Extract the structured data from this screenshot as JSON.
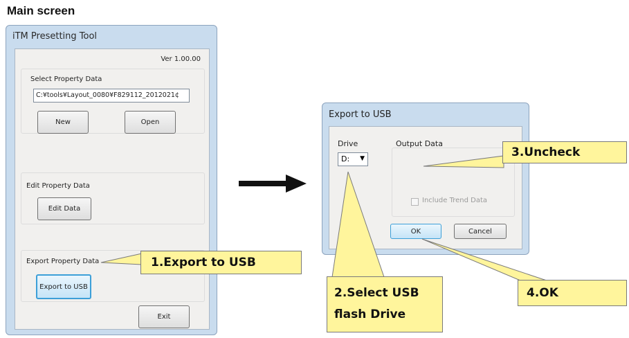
{
  "heading": "Main screen",
  "main_window": {
    "title": "iTM Presetting Tool",
    "version": "Ver 1.00.00",
    "select_group_label": "Select Property Data",
    "path_value": "C:¥tools¥Layout_0080¥F829112_2012021¢",
    "new_label": "New",
    "open_label": "Open",
    "edit_group_label": "Edit Property Data",
    "edit_label": "Edit Data",
    "export_group_label": "Export Property Data",
    "export_label": "Export to USB",
    "exit_label": "Exit"
  },
  "dialog": {
    "title": "Export to USB",
    "drive_label": "Drive",
    "drive_value": "D:",
    "output_label": "Output Data",
    "include_trend_label": "Include Trend Data",
    "include_trend_checked": false,
    "ok_label": "OK",
    "cancel_label": "Cancel"
  },
  "callouts": {
    "step1": "1.Export to USB",
    "step2_line1": "2.Select USB",
    "step2_line2": "flash Drive",
    "step3": "3.Uncheck",
    "step4": "4.OK"
  },
  "colors": {
    "callout_fill": "#fff59c",
    "window_frame": "#c9dcee",
    "focus_border": "#3c9fd8"
  }
}
